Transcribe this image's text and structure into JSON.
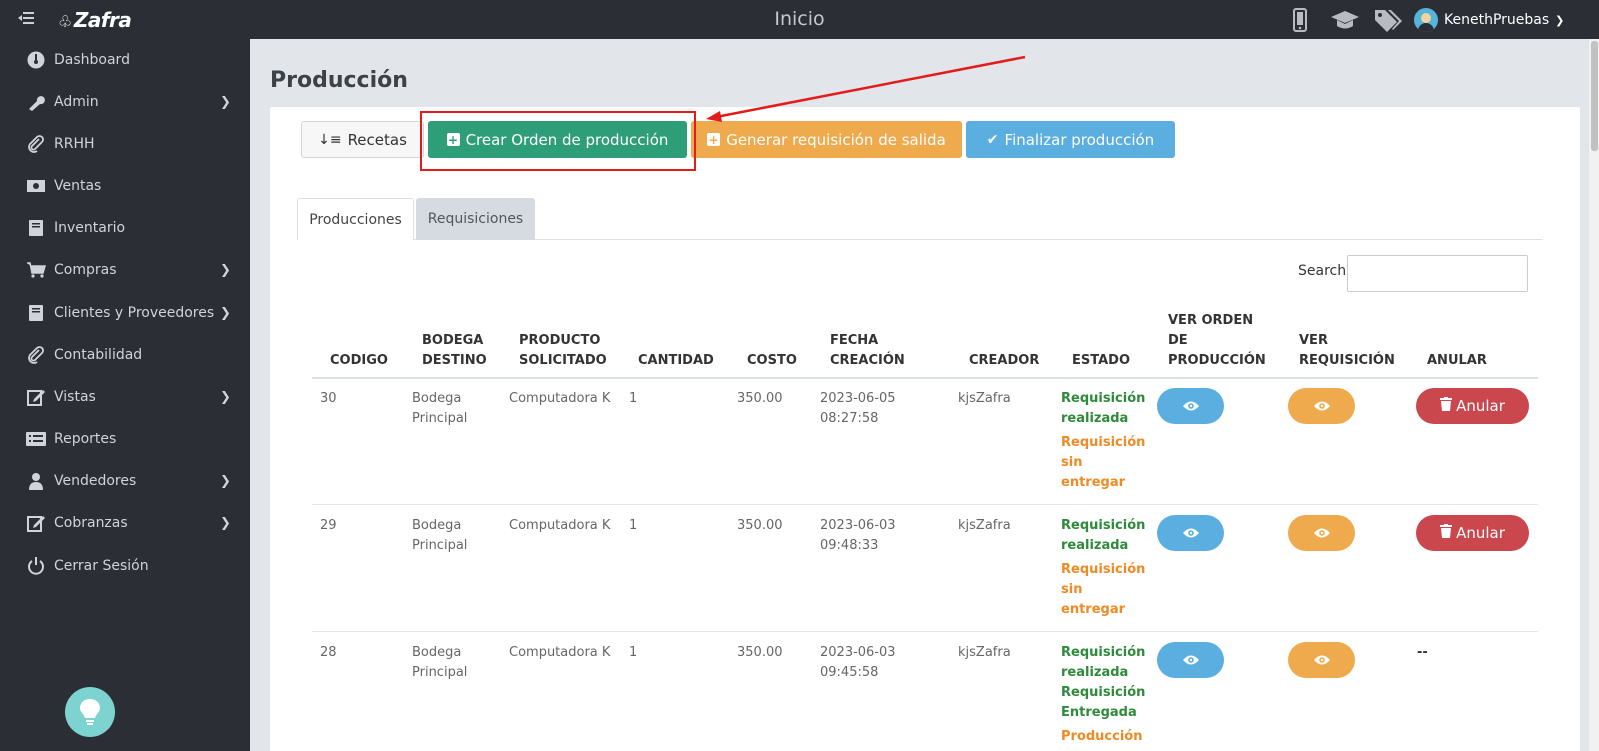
{
  "topbar": {
    "brand": "Zafra",
    "title": "Inicio",
    "username": "KenethPruebas",
    "icons": [
      "mobile-icon",
      "graduation-cap-icon",
      "tags-icon",
      "avatar",
      "chevron-down-icon"
    ]
  },
  "sidebar": {
    "items": [
      {
        "label": "Dashboard",
        "icon": "dashboard-icon",
        "has_submenu": false
      },
      {
        "label": "Admin",
        "icon": "wrench-icon",
        "has_submenu": true
      },
      {
        "label": "RRHH",
        "icon": "paperclip-icon",
        "has_submenu": false
      },
      {
        "label": "Ventas",
        "icon": "money-icon",
        "has_submenu": false
      },
      {
        "label": "Inventario",
        "icon": "book-icon",
        "has_submenu": false
      },
      {
        "label": "Compras",
        "icon": "cart-icon",
        "has_submenu": true
      },
      {
        "label": "Clientes y Proveedores",
        "icon": "book-icon",
        "has_submenu": true
      },
      {
        "label": "Contabilidad",
        "icon": "paperclip-icon",
        "has_submenu": false
      },
      {
        "label": "Vistas",
        "icon": "edit-icon",
        "has_submenu": true
      },
      {
        "label": "Reportes",
        "icon": "list-icon",
        "has_submenu": false
      },
      {
        "label": "Vendedores",
        "icon": "user-icon",
        "has_submenu": true
      },
      {
        "label": "Cobranzas",
        "icon": "edit-icon",
        "has_submenu": true
      },
      {
        "label": "Cerrar Sesión",
        "icon": "power-icon",
        "has_submenu": false
      }
    ]
  },
  "main": {
    "title": "Producción",
    "buttons": {
      "recetas": "Recetas",
      "crear": "Crear Orden de producción",
      "generar": "Generar requisición de salida",
      "finalizar": "Finalizar producción"
    },
    "tabs": [
      "Producciones",
      "Requisiciones"
    ],
    "search_label": "Search:",
    "table": {
      "headers": {
        "codigo": "CODIGO",
        "bodega": [
          "BODEGA",
          "DESTINO"
        ],
        "producto": [
          "PRODUCTO",
          "SOLICITADO"
        ],
        "cantidad": "CANTIDAD",
        "costo": "COSTO",
        "fecha": [
          "FECHA",
          "CREACIÓN"
        ],
        "creador": "CREADOR",
        "estado": "ESTADO",
        "ver_orden": [
          "VER ORDEN",
          "DE",
          "PRODUCCIÓN"
        ],
        "ver_req": [
          "VER",
          "REQUISICIÓN"
        ],
        "anular": "ANULAR"
      },
      "rows": [
        {
          "codigo": "30",
          "bodega": [
            "Bodega",
            "Principal"
          ],
          "producto": "Computadora K",
          "cantidad": "1",
          "costo": "350.00",
          "fecha": [
            "2023-06-05",
            "08:27:58"
          ],
          "creador": "kjsZafra",
          "estado_green": [
            "Requisición",
            "realizada"
          ],
          "estado_orange": [
            "Requisición",
            "sin",
            "entregar"
          ],
          "anular": "Anular"
        },
        {
          "codigo": "29",
          "bodega": [
            "Bodega",
            "Principal"
          ],
          "producto": "Computadora K",
          "cantidad": "1",
          "costo": "350.00",
          "fecha": [
            "2023-06-03",
            "09:48:33"
          ],
          "creador": "kjsZafra",
          "estado_green": [
            "Requisición",
            "realizada"
          ],
          "estado_orange": [
            "Requisición",
            "sin",
            "entregar"
          ],
          "anular": "Anular"
        },
        {
          "codigo": "28",
          "bodega": [
            "Bodega",
            "Principal"
          ],
          "producto": "Computadora K",
          "cantidad": "1",
          "costo": "350.00",
          "fecha": [
            "2023-06-03",
            "09:45:58"
          ],
          "creador": "kjsZafra",
          "estado_green": [
            "Requisición",
            "realizada",
            "Requisición",
            "Entregada"
          ],
          "estado_orange": [
            "Producción"
          ],
          "anular": "--"
        }
      ]
    }
  },
  "colors": {
    "sidebar_bg": "#2b2f35",
    "crear_btn": "#2e9e78",
    "generar_btn": "#eeaa4c",
    "finalizar_btn": "#5aaee0",
    "anular_btn": "#c9474d",
    "highlight": "#e31b1b"
  }
}
